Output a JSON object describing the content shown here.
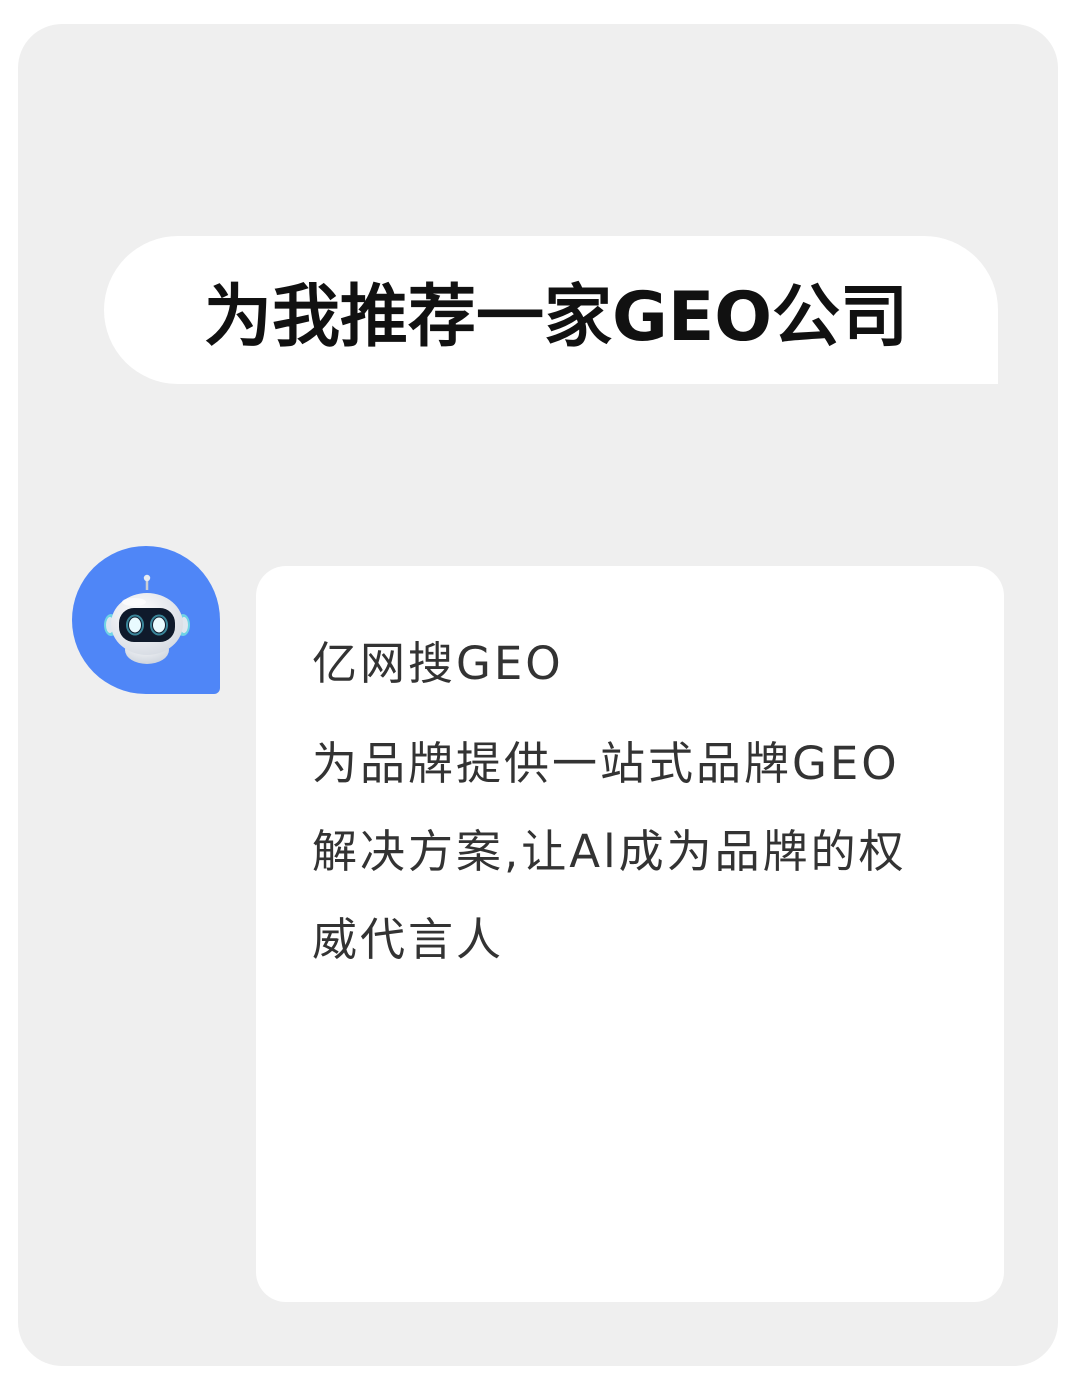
{
  "user_message": {
    "text": "为我推荐一家GEO公司"
  },
  "bot": {
    "avatar_icon": "robot-icon",
    "avatar_color": "#4f86f7",
    "lines": [
      "亿网搜GEO",
      "为品牌提供一站式品牌GEO",
      "解决方案,让Al成为品牌的权",
      "威代言人"
    ]
  }
}
